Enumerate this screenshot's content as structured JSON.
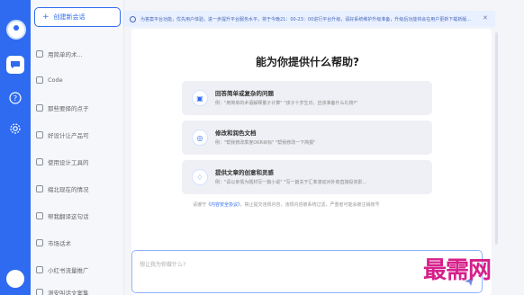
{
  "sidebar": {
    "new_chat_label": "创建新会话",
    "history": [
      "用简单的术...",
      "Code",
      "那些要择的点子",
      "好设计让产品可",
      "使用设计工具的",
      "缀北现在的情况",
      "帮我翻译这句话",
      "市场话术",
      "小红书流量推广",
      "测安叫话文案集"
    ]
  },
  "notice": {
    "text": "为答案平台功能，优先用户体验，进一步提升平台服务水平，将于今晚21：00-23：00进行平台升级，请好系统维护升级准备，升级后功能将会在用户更新下载新版..."
  },
  "main": {
    "title": "能为你提供什么帮助?",
    "cards": [
      {
        "icon": "chat-icon",
        "title": "回答简单或复杂的问题",
        "desc": "例：\"用简单的术语解释量子计算\"  \"孩子十岁生日，应该准备什么礼物?\""
      },
      {
        "icon": "edit-icon",
        "title": "修改和润色文档",
        "desc": "例：\"帮我修改季度OKR目标\"  \"帮我修改一下简报\""
      },
      {
        "icon": "bulb-icon",
        "title": "提供文章的创意和灵感",
        "desc": "例：\"请以亲情为题材写一篇小说\"  \"写一篇关于汇率波动对外商直接投资影..."
      }
    ],
    "disclaimer_pre": "请遵守",
    "disclaimer_link": "《内容安全协议》",
    "disclaimer_post": "，禁止提交违规内容，违规内容被系统过滤，严重者可能会被注销账号",
    "input_placeholder": "想让我为你做什么?"
  },
  "watermark": "最需网",
  "colors": {
    "accent": "#2f6bf0",
    "watermark": "#d61f8a"
  }
}
